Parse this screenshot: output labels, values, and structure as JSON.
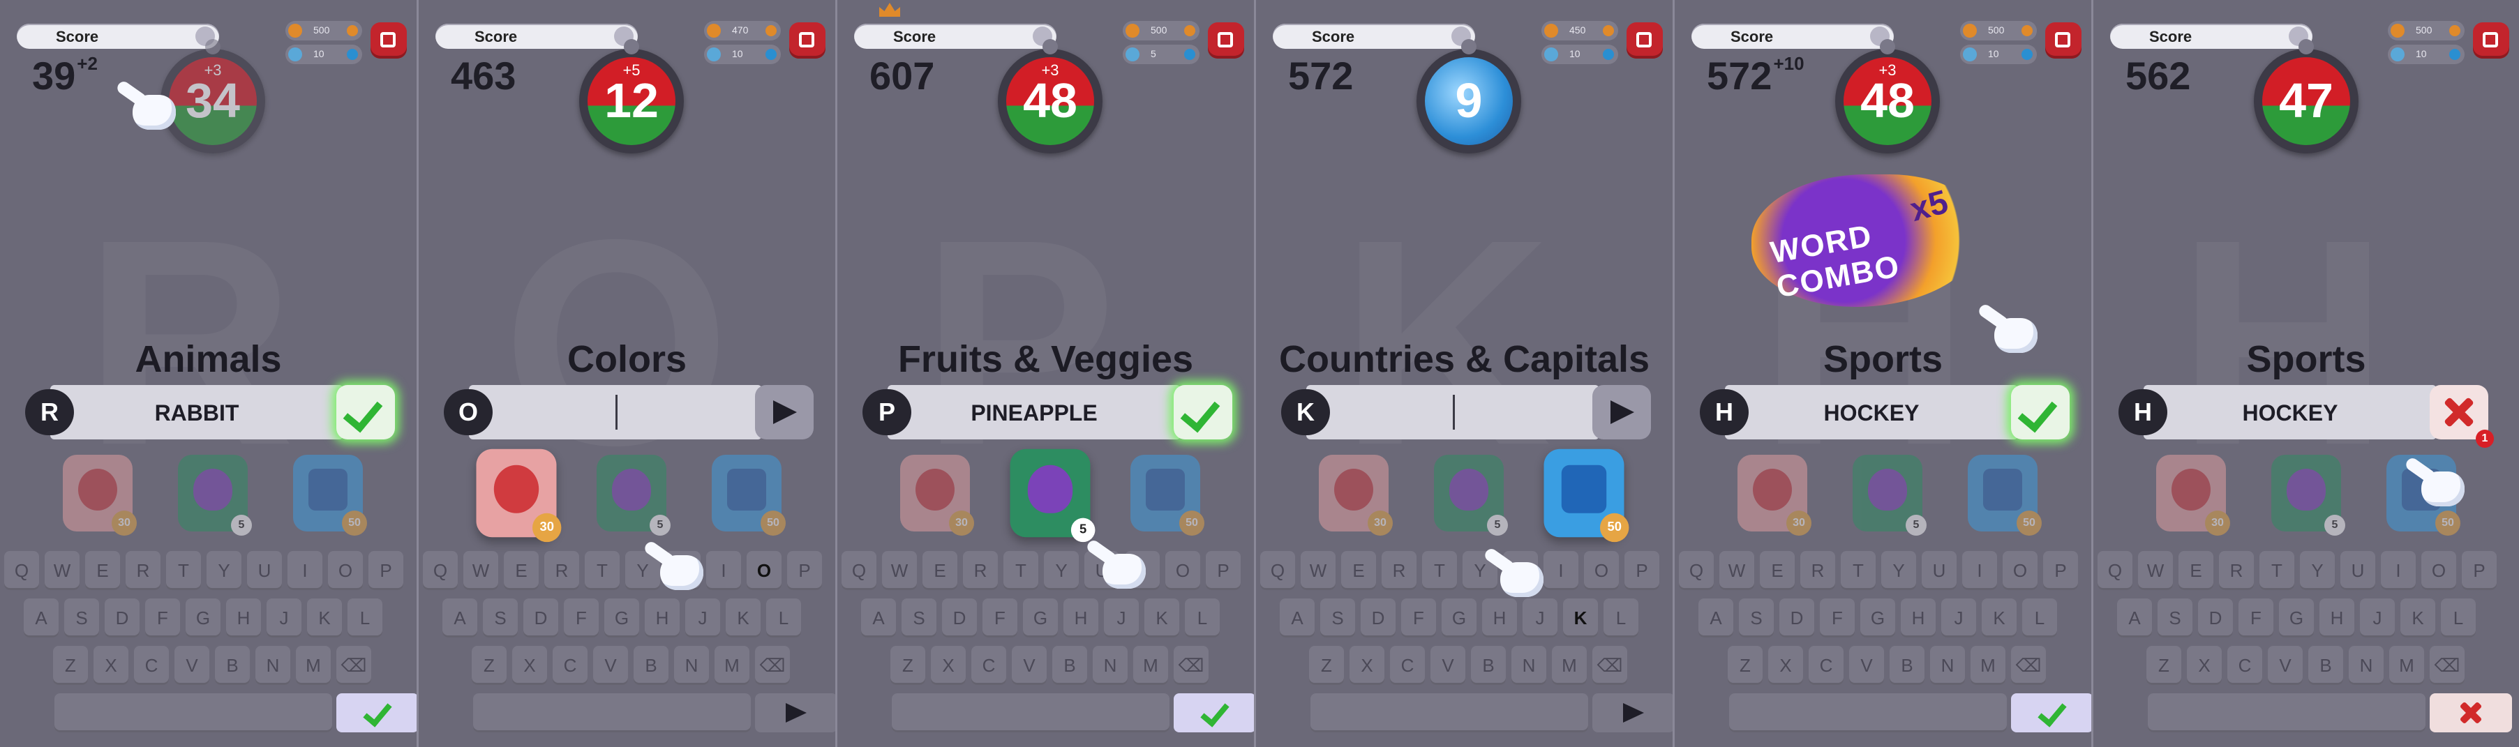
{
  "hud_label": "Score",
  "panels": [
    {
      "score": "39",
      "bonus": "+2",
      "coins": "500",
      "tickets": "10",
      "timer": "34",
      "timer_bonus": "+3",
      "category": "Animals",
      "letter": "R",
      "answer": "RABBIT",
      "action": "check",
      "enter": "check",
      "highlight_key": "",
      "active_powerup": ""
    },
    {
      "score": "463",
      "bonus": "",
      "coins": "470",
      "tickets": "10",
      "timer": "12",
      "timer_bonus": "+5",
      "category": "Colors",
      "letter": "O",
      "answer": "",
      "action": "arrow",
      "enter": "arrow",
      "highlight_key": "O",
      "active_powerup": "rewind"
    },
    {
      "score": "607",
      "bonus": "",
      "coins": "500",
      "tickets": "5",
      "timer": "48",
      "timer_bonus": "+3",
      "category": "Fruits & Veggies",
      "letter": "P",
      "answer": "PINEAPPLE",
      "action": "check",
      "enter": "check",
      "highlight_key": "",
      "active_powerup": "bomb"
    },
    {
      "score": "572",
      "bonus": "",
      "coins": "450",
      "tickets": "10",
      "timer": "9",
      "timer_bonus": "",
      "category": "Countries & Capitals",
      "letter": "K",
      "answer": "",
      "action": "arrow",
      "enter": "arrow",
      "highlight_key": "K",
      "active_powerup": "freeze"
    },
    {
      "score": "572",
      "bonus": "+10",
      "coins": "500",
      "tickets": "10",
      "timer": "48",
      "timer_bonus": "+3",
      "category": "Sports",
      "letter": "H",
      "answer": "HOCKEY",
      "action": "check",
      "enter": "check",
      "highlight_key": "",
      "active_powerup": ""
    },
    {
      "score": "562",
      "bonus": "",
      "coins": "500",
      "tickets": "10",
      "timer": "47",
      "timer_bonus": "",
      "category": "Sports",
      "letter": "H",
      "answer": "HOCKEY",
      "action": "cross",
      "enter": "cross",
      "highlight_key": "",
      "active_powerup": "",
      "error_count": "1"
    }
  ],
  "powerup_costs": {
    "rewind": "30",
    "bomb": "5",
    "freeze": "50"
  },
  "keyboard_rows": [
    [
      "Q",
      "W",
      "E",
      "R",
      "T",
      "Y",
      "U",
      "I",
      "O",
      "P"
    ],
    [
      "A",
      "S",
      "D",
      "F",
      "G",
      "H",
      "J",
      "K",
      "L"
    ],
    [
      "Z",
      "X",
      "C",
      "V",
      "B",
      "N",
      "M",
      "⌫"
    ]
  ],
  "combo": {
    "text": "WORD COMBO",
    "multiplier": "x5"
  },
  "icons": {
    "rewind": "rewind-icon",
    "bomb": "bomb-icon",
    "freeze": "freeze-icon",
    "menu": "menu-icon",
    "coin": "coin-icon",
    "ticket": "ticket-icon",
    "hand": "hand-pointer-icon"
  },
  "colors": {
    "accent_red": "#c3242c",
    "success_green": "#2fb534",
    "freeze_blue": "#3a9ee2"
  }
}
